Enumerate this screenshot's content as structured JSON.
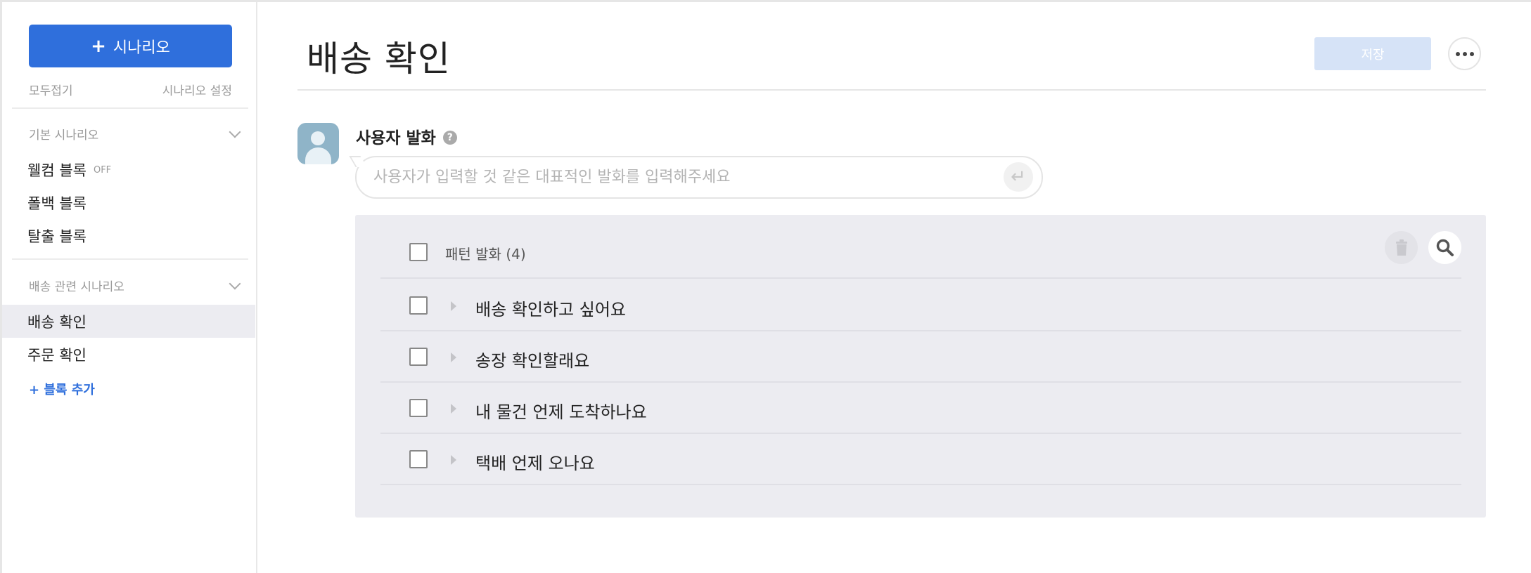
{
  "sidebar": {
    "add_scenario_label": "시나리오",
    "collapse_all": "모두접기",
    "scenario_settings": "시나리오 설정",
    "groups": [
      {
        "title": "기본 시나리오",
        "items": [
          {
            "label": "웰컴 블록",
            "badge": "OFF"
          },
          {
            "label": "폴백 블록"
          },
          {
            "label": "탈출 블록"
          }
        ]
      },
      {
        "title": "배송 관련 시나리오",
        "items": [
          {
            "label": "배송 확인",
            "active": true
          },
          {
            "label": "주문 확인"
          }
        ]
      }
    ],
    "add_block": "+ 블록 추가"
  },
  "main": {
    "title": "배송 확인",
    "save_label": "저장",
    "utterance": {
      "label": "사용자 발화",
      "help": "?",
      "placeholder": "사용자가 입력할 것 같은 대표적인 발화를 입력해주세요",
      "value": ""
    },
    "patterns": {
      "header": "패턴 발화 (4)",
      "rows": [
        "배송 확인하고 싶어요",
        "송장 확인할래요",
        "내 물건 언제 도착하나요",
        "택배 언제 오나요"
      ]
    }
  },
  "colors": {
    "accent": "#2f6fdc",
    "save_disabled": "#d6e3f7",
    "panel_bg": "#ececf1",
    "active_item_bg": "#ececf1"
  },
  "icons": [
    "plus-icon",
    "chevron-down-icon",
    "more-icon",
    "user-avatar-icon",
    "help-icon",
    "enter-icon",
    "trash-icon",
    "search-icon",
    "caret-right-icon"
  ]
}
